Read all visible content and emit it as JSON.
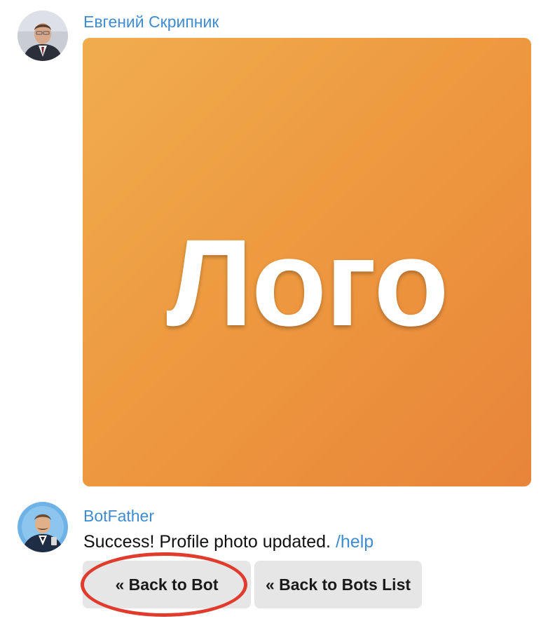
{
  "messages": [
    {
      "sender": "Евгений Скрипник",
      "avatar": "user-photo-avatar",
      "photo": {
        "text": "Лого",
        "gradient_colors": [
          "#f0ad4d",
          "#e8843a"
        ],
        "text_color": "#ffffff"
      }
    },
    {
      "sender": "BotFather",
      "avatar": "botfather-avatar",
      "text": "Success! Profile photo updated. ",
      "command_link": "/help",
      "keyboard": [
        {
          "label": "« Back to Bot",
          "highlighted": true
        },
        {
          "label": "« Back to Bots List"
        }
      ]
    }
  ],
  "colors": {
    "sender_name": "#3f8cd0",
    "link": "#3f8cd0",
    "button_bg": "#e6e6e6",
    "highlight_ring": "#e03b2c"
  }
}
